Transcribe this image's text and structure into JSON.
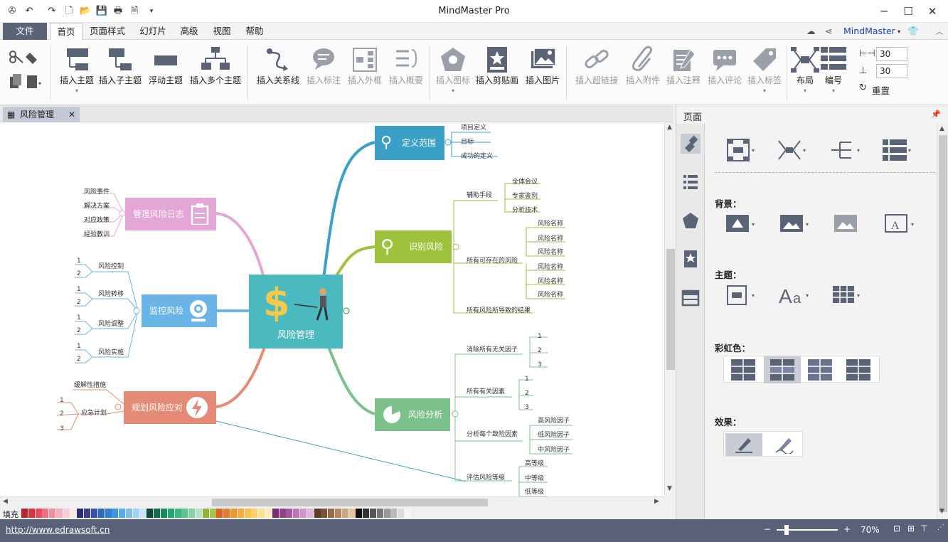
{
  "window": {
    "title": "MindMaster Pro"
  },
  "menu": {
    "file": "文件",
    "tabs": [
      "首页",
      "页面样式",
      "幻灯片",
      "高级",
      "视图",
      "帮助"
    ],
    "account": "MindMaster"
  },
  "ribbon": {
    "insert_topic": "插入主题",
    "insert_subtopic": "插入子主题",
    "floating_topic": "浮动主题",
    "insert_multiple": "插入多个主题",
    "insert_relationship": "插入关系线",
    "insert_callout": "插入标注",
    "insert_boundary": "插入外框",
    "insert_summary": "插入概要",
    "insert_icon": "插入图标",
    "insert_clipart": "插入剪贴画",
    "insert_picture": "插入图片",
    "insert_hyperlink": "插入超链接",
    "insert_attachment": "插入附件",
    "insert_note": "插入注释",
    "insert_comment": "插入评论",
    "insert_tag": "插入标签",
    "layout": "布局",
    "numbering": "编号",
    "spacing_h": "30",
    "spacing_v": "30",
    "reset": "重置"
  },
  "doc_tab": {
    "title": "风险管理"
  },
  "mindmap": {
    "center": "风险管理",
    "define_scope": {
      "label": "定义范围",
      "children": [
        "项目定义",
        "目标",
        "成功的定义"
      ]
    },
    "identify": {
      "label": "识别风险",
      "aux": "辅助手段",
      "aux_children": [
        "全体会议",
        "专家鉴别",
        "分析技术"
      ],
      "possible": "所有可存在的风险",
      "possible_children": [
        "风险名称",
        "风险名称",
        "风险名称",
        "风险名称",
        "风险名称",
        "风险名称"
      ],
      "results": "所有风险所导致的结果"
    },
    "analysis": {
      "label": "风险分析",
      "eliminate": "消除所有无关因子",
      "eliminate_children": [
        "1",
        "2",
        "3"
      ],
      "related": "所有有关因素",
      "related_children": [
        "1",
        "2",
        "3"
      ],
      "analyze": "分析每个致险因素",
      "analyze_children": [
        "高风险因子",
        "低风险因子",
        "中风险因子"
      ],
      "evaluate": "评估风险等级",
      "evaluate_children": [
        "高等级",
        "中等级",
        "低等级"
      ]
    },
    "log": {
      "label": "管理风险日志",
      "children": [
        "风险事件",
        "解决方案",
        "对应政策",
        "经验教训"
      ]
    },
    "monitor": {
      "label": "监控风险",
      "children": [
        "风险控制",
        "风险转移",
        "风险调整",
        "风险实施"
      ],
      "nums": [
        "1",
        "2"
      ]
    },
    "plan": {
      "label": "规划风险应对",
      "mitigate": "缓解性措施",
      "contingency": "应急计划",
      "nums": [
        "1",
        "2",
        "3"
      ]
    }
  },
  "palette": {
    "label": "填充"
  },
  "status": {
    "url": "http://www.edrawsoft.cn",
    "zoom": "70%"
  },
  "panel": {
    "title": "页面",
    "background": "背景：",
    "theme": "主题：",
    "rainbow": "彩虹色：",
    "effect": "效果："
  }
}
